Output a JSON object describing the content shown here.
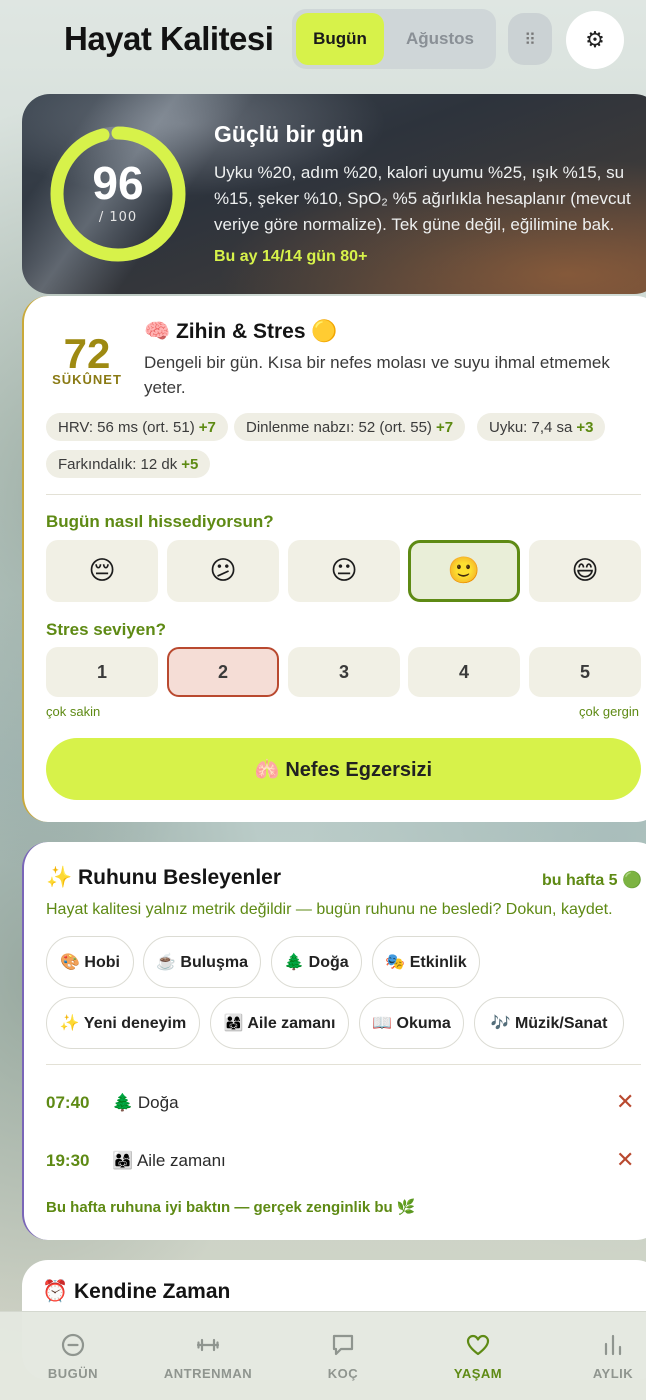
{
  "header": {
    "title": "Hayat Kalitesi",
    "segments": [
      "Bugün",
      "Ağustos"
    ],
    "grid_icon": "⠿",
    "gear_icon": "⚙"
  },
  "hero": {
    "score": "96",
    "score_value": 96,
    "max_label": "/ 100",
    "title": "Güçlü bir gün",
    "description": "Uyku %20, adım %20, kalori uyumu %25, ışık %15, su %15, şeker %10, SpO₂ %5 ağırlıkla hesaplanır (mevcut veriye göre normalize). Tek güne değil, eğilimine bak.",
    "month_summary": "Bu ay 14/14 gün 80+",
    "ring_color": "#d7f24a"
  },
  "mind": {
    "calm_score": "72",
    "calm_label": "SÜKÛNET",
    "title": "🧠 Zihin & Stres 🟡",
    "description": "Dengeli bir gün. Kısa bir nefes molası ve suyu ihmal etmemek yeter.",
    "chips": [
      {
        "text": "HRV: 56 ms (ort. 51)",
        "delta": "+7"
      },
      {
        "text": "Dinlenme nabzı: 52 (ort. 55)",
        "delta": "+7"
      },
      {
        "text": "Uyku: 7,4 sa",
        "delta": "+3"
      },
      {
        "text": "Farkındalık: 12 dk",
        "delta": "+5"
      }
    ],
    "mood_question": "Bugün nasıl hissediyorsun?",
    "moods": [
      "😔",
      "😕",
      "😐",
      "🙂",
      "😄"
    ],
    "stress_question": "Stres seviyen?",
    "stress_levels": [
      "1",
      "2",
      "3",
      "4",
      "5"
    ],
    "scale_low": "çok sakin",
    "scale_high": "çok gergin",
    "breath_button": "🫁 Nefes Egzersizi"
  },
  "soul": {
    "title": "✨ Ruhunu Besleyenler",
    "week_count": "bu hafta 5 🟢",
    "description": "Hayat kalitesi yalnız metrik değildir — bugün ruhunu ne besledi? Dokun, kaydet.",
    "tags": [
      "🎨 Hobi",
      "☕ Buluşma",
      "🌲 Doğa",
      "🎭 Etkinlik",
      "✨ Yeni deneyim",
      "👨‍👩‍👧 Aile zamanı",
      "📖 Okuma",
      "🎶 Müzik/Sanat"
    ],
    "logs": [
      {
        "time": "07:40",
        "activity": "🌲 Doğa",
        "delete": "✕"
      },
      {
        "time": "19:30",
        "activity": "👨‍👩‍👧 Aile zamanı",
        "delete": "✕"
      }
    ],
    "footer": "Bu hafta ruhuna iyi baktın — gerçek zenginlik bu 🌿"
  },
  "time_card": {
    "title": "⏰ Kendine Zaman"
  },
  "tabbar": {
    "tabs": [
      {
        "label": "BUGÜN",
        "icon": "minus-circle-icon"
      },
      {
        "label": "ANTRENMAN",
        "icon": "dumbbell-icon"
      },
      {
        "label": "KOÇ",
        "icon": "chat-bubble-icon"
      },
      {
        "label": "YAŞAM",
        "icon": "heart-icon"
      },
      {
        "label": "AYLIK",
        "icon": "bar-chart-icon"
      }
    ],
    "active_tab": "YAŞAM"
  }
}
